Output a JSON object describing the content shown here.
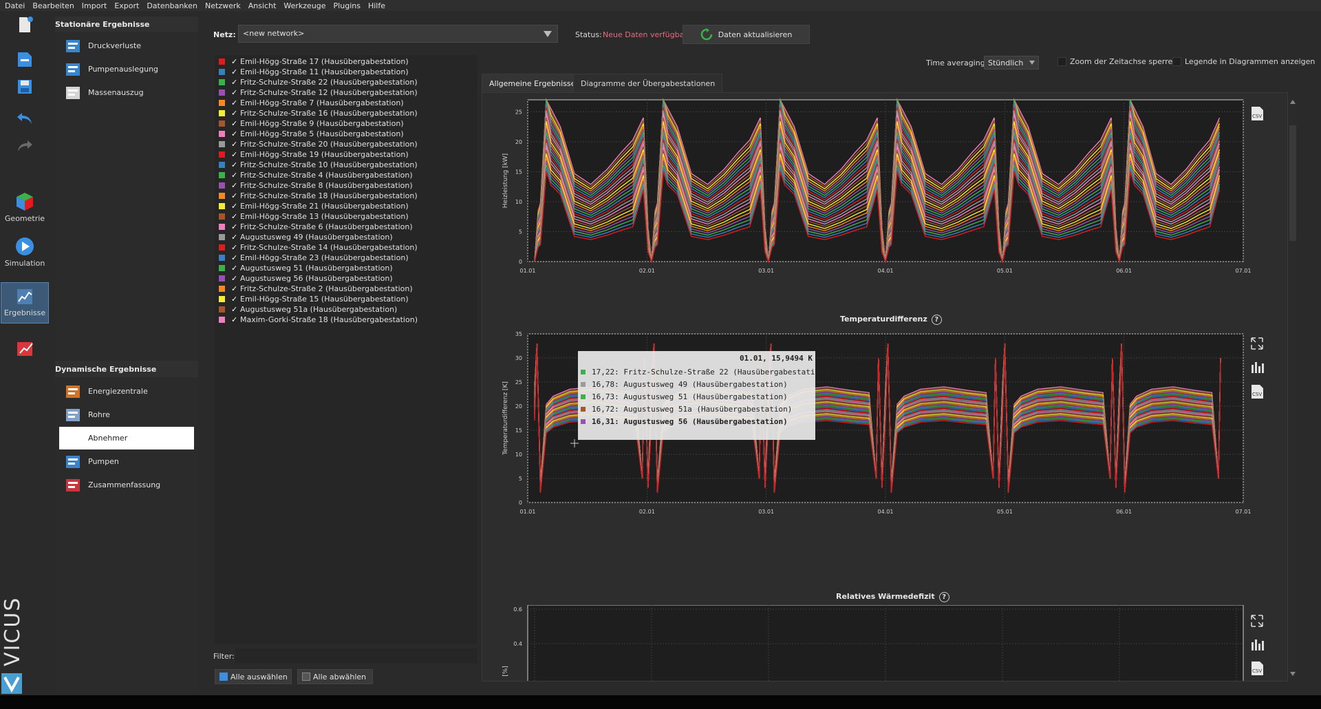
{
  "menu": [
    "Datei",
    "Bearbeiten",
    "Import",
    "Export",
    "Datenbanken",
    "Netzwerk",
    "Ansicht",
    "Werkzeuge",
    "Plugins",
    "Hilfe"
  ],
  "toolbar": {
    "geometry_label": "Geometrie",
    "simulation_label": "Simulation",
    "results_label": "Ergebnisse",
    "logo_text": "VICUS"
  },
  "stationary": {
    "title": "Stationäre Ergebnisse",
    "items": [
      {
        "label": "Druckverluste",
        "icon": "pressure-loss-icon"
      },
      {
        "label": "Pumpenauslegung",
        "icon": "pump-design-icon"
      },
      {
        "label": "Massenauszug",
        "icon": "bill-of-materials-icon"
      }
    ]
  },
  "dynamic": {
    "title": "Dynamische Ergebnisse",
    "items": [
      {
        "label": "Energiezentrale",
        "icon": "energy-center-icon"
      },
      {
        "label": "Rohre",
        "icon": "pipes-icon"
      },
      {
        "label": "Abnehmer",
        "icon": "consumer-icon",
        "selected": true
      },
      {
        "label": "Pumpen",
        "icon": "pump-icon"
      },
      {
        "label": "Zusammenfassung",
        "icon": "summary-icon"
      }
    ]
  },
  "network": {
    "label": "Netz:",
    "value": "<new network>"
  },
  "status": {
    "label": "Status:",
    "value": "Neue Daten verfügbar",
    "refresh_label": "Daten aktualisieren"
  },
  "stations": [
    {
      "label": "Emil-Högg-Straße 17 (Hausübergabestation)",
      "color": "#e31a1c"
    },
    {
      "label": "Emil-Högg-Straße 11 (Hausübergabestation)",
      "color": "#3a7fc4"
    },
    {
      "label": "Fritz-Schulze-Straße 22 (Hausübergabestation)",
      "color": "#3cb14a"
    },
    {
      "label": "Fritz-Schulze-Straße 12 (Hausübergabestation)",
      "color": "#9b4fb4"
    },
    {
      "label": "Emil-Högg-Straße 7 (Hausübergabestation)",
      "color": "#f7891e"
    },
    {
      "label": "Fritz-Schulze-Straße 16 (Hausübergabestation)",
      "color": "#f5ec35"
    },
    {
      "label": "Emil-Högg-Straße 9 (Hausübergabestation)",
      "color": "#a5572b"
    },
    {
      "label": "Emil-Högg-Straße 5 (Hausübergabestation)",
      "color": "#f27ec0"
    },
    {
      "label": "Fritz-Schulze-Straße 20 (Hausübergabestation)",
      "color": "#9a9a9a"
    },
    {
      "label": "Emil-Högg-Straße 19 (Hausübergabestation)",
      "color": "#e31a1c"
    },
    {
      "label": "Fritz-Schulze-Straße 10 (Hausübergabestation)",
      "color": "#3a7fc4"
    },
    {
      "label": "Fritz-Schulze-Straße 4 (Hausübergabestation)",
      "color": "#3cb14a"
    },
    {
      "label": "Fritz-Schulze-Straße 8 (Hausübergabestation)",
      "color": "#9b4fb4"
    },
    {
      "label": "Fritz-Schulze-Straße 18 (Hausübergabestation)",
      "color": "#f7891e"
    },
    {
      "label": "Emil-Högg-Straße 21 (Hausübergabestation)",
      "color": "#f5ec35"
    },
    {
      "label": "Emil-Högg-Straße 13 (Hausübergabestation)",
      "color": "#a5572b"
    },
    {
      "label": "Fritz-Schulze-Straße 6 (Hausübergabestation)",
      "color": "#f27ec0"
    },
    {
      "label": "Augustusweg 49 (Hausübergabestation)",
      "color": "#9a9a9a"
    },
    {
      "label": "Fritz-Schulze-Straße 14 (Hausübergabestation)",
      "color": "#e31a1c"
    },
    {
      "label": "Emil-Högg-Straße 23 (Hausübergabestation)",
      "color": "#3a7fc4"
    },
    {
      "label": "Augustusweg 51 (Hausübergabestation)",
      "color": "#3cb14a"
    },
    {
      "label": "Augustusweg 56 (Hausübergabestation)",
      "color": "#9b4fb4"
    },
    {
      "label": "Fritz-Schulze-Straße 2 (Hausübergabestation)",
      "color": "#f7891e"
    },
    {
      "label": "Emil-Högg-Straße 15 (Hausübergabestation)",
      "color": "#f5ec35"
    },
    {
      "label": "Augustusweg 51a (Hausübergabestation)",
      "color": "#a5572b"
    },
    {
      "label": "Maxim-Gorki-Straße 18 (Hausübergabestation)",
      "color": "#f27ec0"
    }
  ],
  "filter": {
    "label": "Filter:",
    "value": ""
  },
  "buttons": {
    "select_all": "Alle auswählen",
    "deselect_all": "Alle abwählen"
  },
  "options": {
    "time_averaging_label": "Time averaging",
    "time_averaging_value": "Stündlich",
    "zoom_lock_label": "Zoom der Zeitachse sperren",
    "legend_label": "Legende in Diagrammen anzeigen"
  },
  "tabs": [
    {
      "label": "Allgemeine Ergebnisse",
      "active": true
    },
    {
      "label": "Diagramme der Übergabestationen",
      "active": false
    }
  ],
  "tooltip": {
    "header": "01.01, 15,9494 K",
    "rows": [
      {
        "text": "17,22: Fritz-Schulze-Straße 22 (Hausübergabestation)",
        "color": "#3cb14a",
        "bold": false
      },
      {
        "text": "16,78: Augustusweg 49 (Hausübergabestation)",
        "color": "#9a9a9a",
        "bold": false
      },
      {
        "text": "16,73: Augustusweg 51 (Hausübergabestation)",
        "color": "#3cb14a",
        "bold": false
      },
      {
        "text": "16,72: Augustusweg 51a (Hausübergabestation)",
        "color": "#a5572b",
        "bold": false
      },
      {
        "text": "16,31: Augustusweg 56 (Hausübergabestation)",
        "color": "#9b4fb4",
        "bold": true
      }
    ]
  },
  "chart_data": [
    {
      "type": "line",
      "title": "",
      "ylabel": "Heizleistung [kW]",
      "xlabel": "",
      "x_ticks": [
        "01.01",
        "02.01",
        "03.01",
        "04.01",
        "05.01",
        "06.01",
        "07.01"
      ],
      "y_ticks": [
        0,
        5,
        10,
        15,
        20,
        25
      ],
      "ylim": [
        0,
        27
      ],
      "xlim": [
        0,
        6
      ],
      "grid": true,
      "series_count": 26,
      "peak_range": [
        15,
        30
      ],
      "base_range": [
        4,
        14
      ]
    },
    {
      "type": "line",
      "title": "Temperaturdifferenz",
      "ylabel": "Temperaturdifferenz [K]",
      "xlabel": "",
      "x_ticks": [
        "01.01",
        "02.01",
        "03.01",
        "04.01",
        "05.01",
        "06.01",
        "07.01"
      ],
      "y_ticks": [
        0,
        5,
        10,
        15,
        20,
        25,
        30,
        35
      ],
      "ylim": [
        0,
        35
      ],
      "xlim": [
        0,
        6
      ],
      "grid": true,
      "series_count": 26,
      "plateau_range": [
        17,
        24
      ]
    },
    {
      "type": "line",
      "title": "Relatives Wärmedefizit",
      "ylabel": "[%]",
      "xlabel": "",
      "y_ticks": [
        0.4,
        0.6
      ],
      "grid": true
    }
  ],
  "side_icons": [
    "csv-export-icon",
    "expand-icon",
    "bar-chart-icon",
    "csv-export-icon",
    "expand-icon",
    "bar-chart-icon",
    "csv-export-icon"
  ]
}
